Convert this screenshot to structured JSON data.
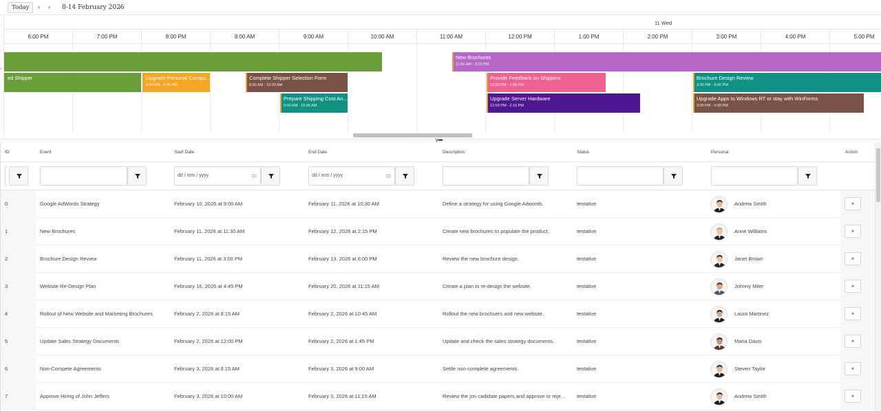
{
  "toolbar": {
    "today_label": "Today",
    "prev_glyph": "‹",
    "next_glyph": "›",
    "range_label": "8-14 February 2026",
    "range_caret": "⌄"
  },
  "timeline": {
    "day_label": "11 Wed",
    "hours": [
      "6:00 PM",
      "7:00 PM",
      "8:00 PM",
      "8:00 AM",
      "9:00 AM",
      "10:00 AM",
      "11:00 AM",
      "12:00 PM",
      "1:00 PM",
      "2:00 PM",
      "3:00 PM",
      "4:00 PM",
      "5:00 PM"
    ],
    "events": [
      {
        "title": "",
        "time": "",
        "color": "#6a9e3a"
      },
      {
        "title": "New Brochures",
        "time": "11:30 AM - 2:15 PM",
        "color": "#b767c7"
      },
      {
        "title": "ed Shipper",
        "time": "",
        "color": "#6a9e3a"
      },
      {
        "title": "Upgrade Personal Compu...",
        "time": "8:00 PM - 9:45 PM",
        "color": "#f5a623"
      },
      {
        "title": "Complete Shipper Selection Form",
        "time": "8:30 AM - 10:00 AM",
        "color": "#7a5346"
      },
      {
        "title": "Provide Feedback on Shippers",
        "time": "12:00 PM - 1:45 PM",
        "color": "#ef6191"
      },
      {
        "title": "Brochure Design Review",
        "time": "3:00 PM - 6:00 PM",
        "color": "#0f9183"
      },
      {
        "title": "Prepare Shipping Cost An...",
        "time": "9:00 AM - 10:00 AM",
        "color": "#0f9183"
      },
      {
        "title": "Upgrade Server Hardware",
        "time": "12:00 PM - 2:15 PM",
        "color": "#4f1791"
      },
      {
        "title": "Upgrade Apps to Windows RT or stay with WinForms",
        "time": "3:00 PM - 5:30 PM",
        "color": "#7a5346"
      }
    ]
  },
  "grid": {
    "columns": [
      "ID",
      "Event",
      "Start Date",
      "End Date",
      "Description",
      "Status",
      "Personal",
      "Action"
    ],
    "date_placeholder": "dd / mm / yyyy",
    "delete_glyph": "×",
    "rows": [
      {
        "id": "0",
        "event": "Google AdWords Strategy",
        "start": "February 10, 2026 at 9:00 AM",
        "end": "February 11, 2026 at 10:30 AM",
        "description": "Define a strategy for using Google Adwords.",
        "status": "tentative",
        "person": "Andrew Smith",
        "avatar": {
          "skin": "#e0b89a",
          "hair": "#2a2a2a",
          "suit": "#1c1c22"
        }
      },
      {
        "id": "1",
        "event": "New Brochures",
        "start": "February 11, 2026 at 11:30 AM",
        "end": "February 12, 2026 at 2:15 PM",
        "description": "Create new brochures to populate the product.",
        "status": "tentative",
        "person": "Anne Williams",
        "avatar": {
          "skin": "#edc6a8",
          "hair": "#c9a46a",
          "suit": "#222226"
        }
      },
      {
        "id": "2",
        "event": "Brochure Design Review",
        "start": "February 11, 2026 at 3:00 PM",
        "end": "February 13, 2026 at 6:00 PM",
        "description": "Review the new brochure design.",
        "status": "tentative",
        "person": "Janet Brown",
        "avatar": {
          "skin": "#e9c3a5",
          "hair": "#3a2a20",
          "suit": "#26262b"
        }
      },
      {
        "id": "3",
        "event": "Website Re-Design Plan",
        "start": "February 16, 2026 at 4:45 PM",
        "end": "February 20, 2026 at 11:15 AM",
        "description": "Create a plan to re-design the website.",
        "status": "tentative",
        "person": "Johnny Miler",
        "avatar": {
          "skin": "#d9a888",
          "hair": "#3b2b22",
          "suit": "#3c5d7a"
        }
      },
      {
        "id": "4",
        "event": "Rollout of New Website and Marketing Brochures",
        "start": "February 2, 2026 at 8:15 AM",
        "end": "February 2, 2026 at 10:45 AM",
        "description": "Rollout the new brochuers and new website.",
        "status": "tentative",
        "person": "Laura Martinez",
        "avatar": {
          "skin": "#d9ab8c",
          "hair": "#1e1714",
          "suit": "#1e1e22"
        }
      },
      {
        "id": "5",
        "event": "Update Sales Strategy Documents",
        "start": "February 2, 2026 at 12:00 PM",
        "end": "February 2, 2026 at 1:45 PM",
        "description": "Update and check the sales strategy documents.",
        "status": "tentative",
        "person": "Maria Davis",
        "avatar": {
          "skin": "#c99276",
          "hair": "#3a2217",
          "suit": "#5a3a30"
        }
      },
      {
        "id": "6",
        "event": "Non-Compete Agreements",
        "start": "February 3, 2026 at 8:15 AM",
        "end": "February 3, 2026 at 9:00 AM",
        "description": "Settle non-complete agreements.",
        "status": "tentative",
        "person": "Steven Taylor",
        "avatar": {
          "skin": "#e3b999",
          "hair": "#2f2621",
          "suit": "#1c1c22"
        }
      },
      {
        "id": "7",
        "event": "Approve Hiring of John Jeffers",
        "start": "February 3, 2026 at 10:00 AM",
        "end": "February 3, 2026 at 11:15 AM",
        "description": "Review the jon cadidate papers and approve or reject th...",
        "status": "tentative",
        "person": "Andrew Smith",
        "avatar": {
          "skin": "#e0b89a",
          "hair": "#2a2a2a",
          "suit": "#1c1c22"
        }
      }
    ]
  }
}
